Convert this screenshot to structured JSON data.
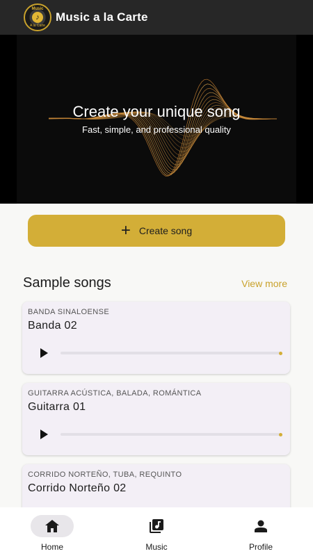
{
  "app": {
    "title": "Music a la Carte",
    "logo_top": "Music",
    "logo_bottom": "A la Carte"
  },
  "hero": {
    "title": "Create your unique song",
    "subtitle": "Fast, simple, and professional quality"
  },
  "create_button": {
    "label": "Create song",
    "icon": "plus-icon"
  },
  "section": {
    "title": "Sample songs",
    "view_more": "View more"
  },
  "songs": [
    {
      "genre": "BANDA SINALOENSE",
      "name": "Banda 02",
      "progress": 0
    },
    {
      "genre": "GUITARRA ACÚSTICA, BALADA, ROMÁNTICA",
      "name": "Guitarra 01",
      "progress": 0
    },
    {
      "genre": "CORRIDO NORTEÑO, TUBA, REQUINTO",
      "name": "Corrido Norteño 02",
      "progress": 0
    }
  ],
  "nav": [
    {
      "label": "Home",
      "icon": "home-icon",
      "active": true
    },
    {
      "label": "Music",
      "icon": "music-library-icon",
      "active": false
    },
    {
      "label": "Profile",
      "icon": "person-icon",
      "active": false
    }
  ],
  "colors": {
    "accent": "#d3ae37",
    "appbar": "#272727",
    "background": "#f8f8f6",
    "card": "#f3eff6"
  }
}
